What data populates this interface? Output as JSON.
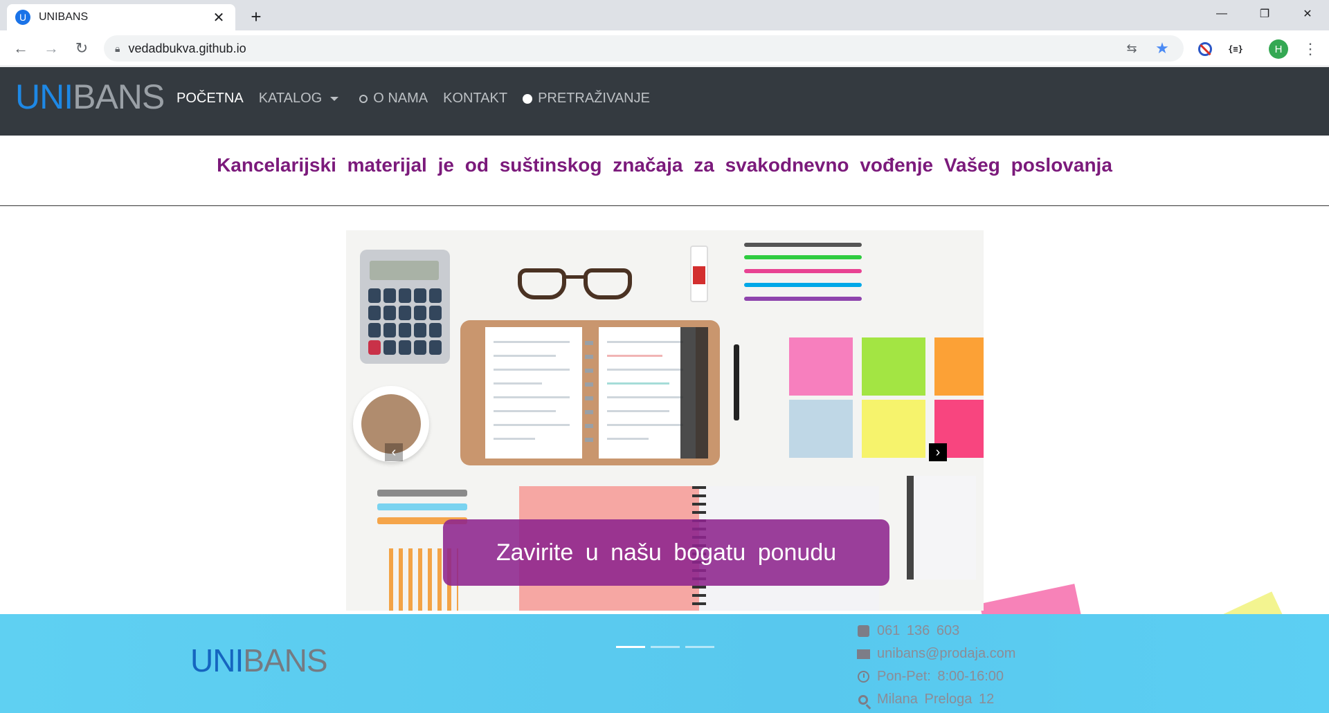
{
  "browser": {
    "tab_title": "UNIBANS",
    "favicon_letter": "U",
    "url": "vedadbukva.github.io",
    "avatar_letter": "H",
    "json_ext_label": "{≡}"
  },
  "site": {
    "brand_part1": "UNI",
    "brand_part2": "BANS",
    "menu": {
      "home": "POČETNA",
      "catalog": "KATALOG",
      "about": "O NAMA",
      "contact": "KONTAKT",
      "search": "PRETRAŽIVANJE"
    },
    "slogan": "Kancelarijski materijal je od suštinskog značaja za svakodnevno vođenje Vašeg poslovanja",
    "carousel": {
      "caption": "Zavirite u našu bogatu ponudu",
      "prev_symbol": "‹",
      "next_symbol": "›",
      "slide_count": 3,
      "active_slide": 1
    },
    "footer": {
      "brand_part1": "UNI",
      "brand_part2": "BANS",
      "phone": "061 136 603",
      "email": "unibans@prodaja.com",
      "hours": "Pon-Pet: 8:00-16:00",
      "address": "Milana Preloga 12"
    }
  },
  "colors": {
    "nav_bg": "#343a40",
    "slogan": "#7b1a7b",
    "caption_bg": "#8d248d",
    "footer_bg": "#5fd0f2",
    "brand_blue": "#1e88e5"
  }
}
